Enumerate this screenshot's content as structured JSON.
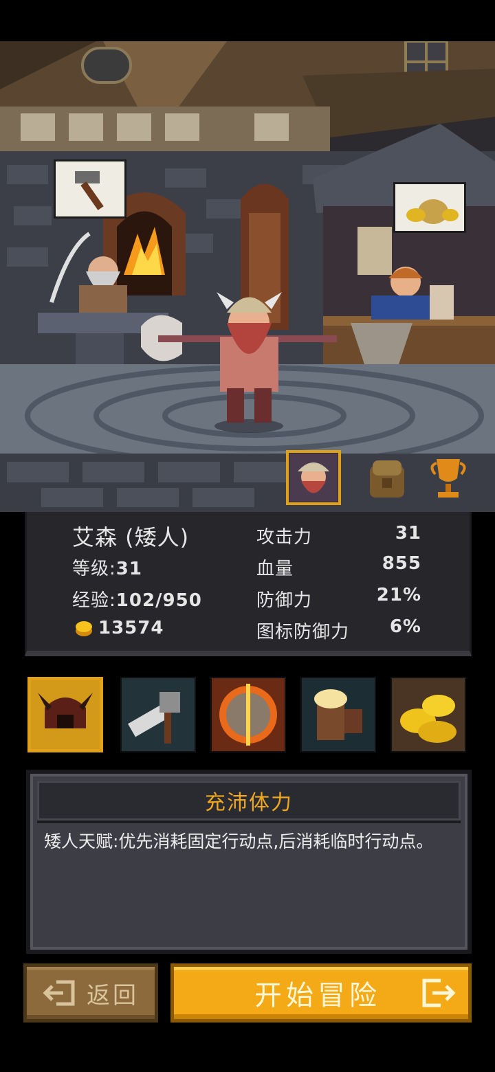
{
  "character": {
    "name": "艾森 (矮人)",
    "level_label": "等级:",
    "level": "31",
    "exp_label": "经验:",
    "exp": "102/950",
    "gold": "13574"
  },
  "stats": [
    {
      "label": "攻击力",
      "value": "31"
    },
    {
      "label": "血量",
      "value": "855"
    },
    {
      "label": "防御力",
      "value": "21%"
    },
    {
      "label": "图标防御力",
      "value": "6%"
    }
  ],
  "tabs": [
    "character-portrait",
    "backpack-icon",
    "trophy-icon"
  ],
  "skills": [
    "horned-helmet-skill",
    "fist-hammer-skill",
    "split-shield-skill",
    "beer-mug-skill",
    "gold-coins-skill"
  ],
  "talent": {
    "title": "充沛体力",
    "description": "矮人天赋:优先消耗固定行动点,后消耗临时行动点。"
  },
  "buttons": {
    "back": "返回",
    "start": "开始冒险"
  },
  "colors": {
    "accent": "#f4a916",
    "title": "#f0a820"
  }
}
